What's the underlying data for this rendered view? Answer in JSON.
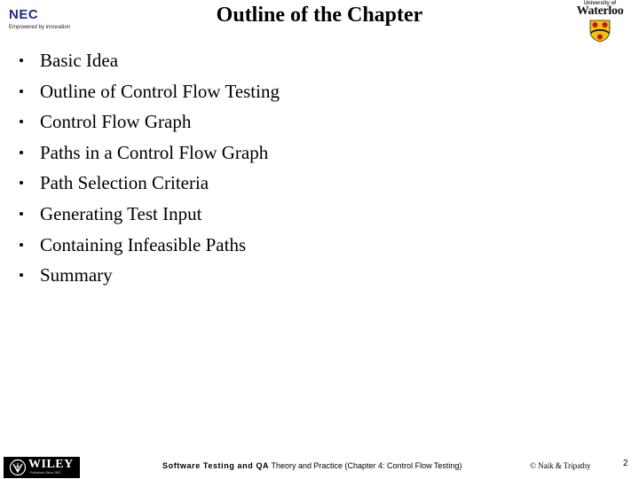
{
  "header": {
    "left_logo": {
      "name": "NEC",
      "tagline": "Empowered by innovation",
      "color": "#1c2c8c"
    },
    "title": "Outline of the Chapter",
    "right_logo": {
      "small_text": "University of",
      "big_text": "Waterloo",
      "crest_colors": {
        "shield": "#f2c500",
        "lion": "#c8102e",
        "chevron": "#000000"
      }
    }
  },
  "outline": {
    "items": [
      {
        "label": "Basic Idea"
      },
      {
        "label": "Outline of Control Flow Testing"
      },
      {
        "label": "Control Flow Graph"
      },
      {
        "label": "Paths in a Control Flow Graph"
      },
      {
        "label": "Path Selection Criteria"
      },
      {
        "label": "Generating Test Input"
      },
      {
        "label": "Containing Infeasible Paths"
      },
      {
        "label": "Summary"
      }
    ]
  },
  "footer": {
    "publisher_logo": {
      "name": "WILEY",
      "tagline": "Publishers Since 1807"
    },
    "book_title_bold": "Software Testing and QA",
    "book_title_rest": " Theory and Practice (Chapter 4: Control Flow Testing)",
    "copyright": "© Naik & Tripathy",
    "page_number": "2"
  }
}
